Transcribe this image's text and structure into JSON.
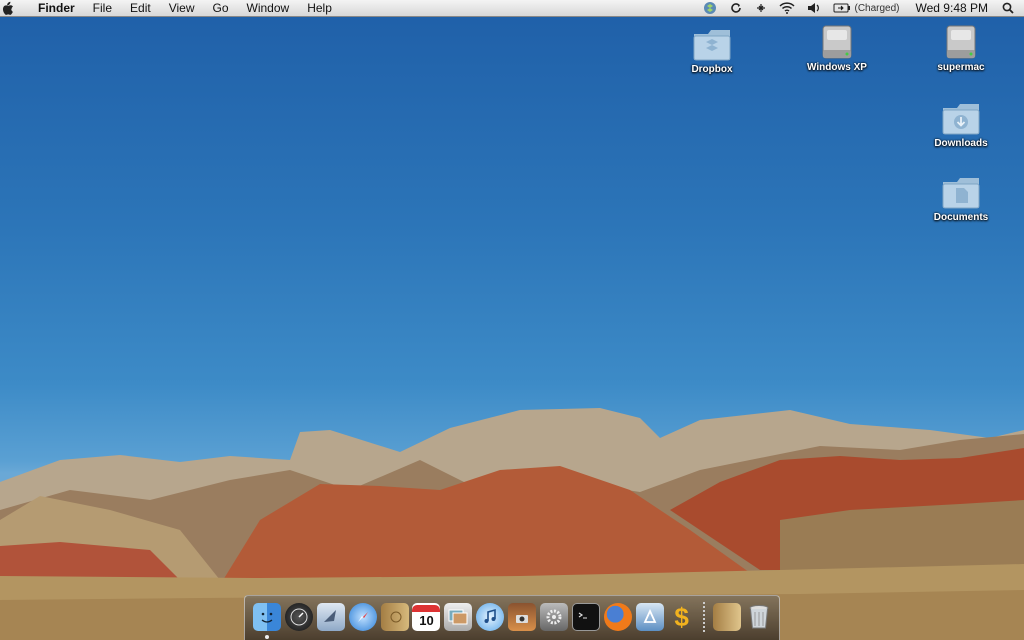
{
  "menubar": {
    "apple_icon": "apple-icon",
    "app_name": "Finder",
    "menus": [
      "File",
      "Edit",
      "View",
      "Go",
      "Window",
      "Help"
    ],
    "status": {
      "battery_text": "(Charged)",
      "clock": "Wed 9:48 PM"
    }
  },
  "desktop": {
    "icons": [
      {
        "label": "Dropbox",
        "icon": "dropbox-folder-icon"
      },
      {
        "label": "Windows XP",
        "icon": "hard-drive-icon"
      },
      {
        "label": "supermac",
        "icon": "hard-drive-icon"
      },
      {
        "label": "Downloads",
        "icon": "downloads-folder-icon"
      },
      {
        "label": "Documents",
        "icon": "documents-folder-icon"
      }
    ]
  },
  "dock": {
    "apps": [
      {
        "name": "Finder",
        "icon": "finder-icon",
        "running": true
      },
      {
        "name": "Dashboard",
        "icon": "dashboard-icon"
      },
      {
        "name": "Mail",
        "icon": "mail-icon"
      },
      {
        "name": "Safari",
        "icon": "safari-icon"
      },
      {
        "name": "Address Book",
        "icon": "address-book-icon"
      },
      {
        "name": "iCal",
        "icon": "ical-icon",
        "badge": "10"
      },
      {
        "name": "iPhoto",
        "icon": "photo-icon"
      },
      {
        "name": "iTunes",
        "icon": "itunes-icon"
      },
      {
        "name": "Photo Booth",
        "icon": "photo-booth-icon"
      },
      {
        "name": "System Preferences",
        "icon": "system-preferences-icon"
      },
      {
        "name": "Terminal",
        "icon": "terminal-icon"
      },
      {
        "name": "Firefox",
        "icon": "firefox-icon"
      },
      {
        "name": "App Store",
        "icon": "app-icon"
      },
      {
        "name": "Money",
        "icon": "dollar-icon",
        "glyph": "$"
      }
    ],
    "stacks": [
      {
        "name": "Documents",
        "icon": "documents-stack-icon"
      },
      {
        "name": "Trash",
        "icon": "trash-icon"
      }
    ]
  }
}
